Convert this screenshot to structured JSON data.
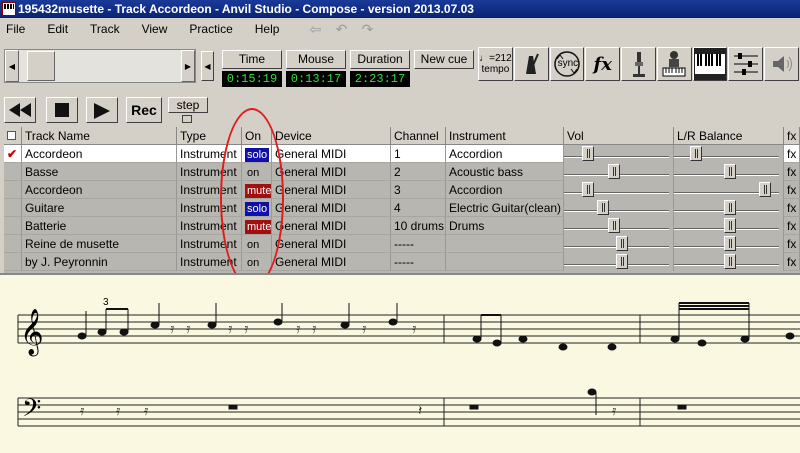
{
  "window": {
    "title": "195432musette - Track Accordeon - Anvil Studio - Compose - version 2013.07.03"
  },
  "menu": {
    "items": [
      "File",
      "Edit",
      "Track",
      "View",
      "Practice",
      "Help"
    ]
  },
  "toolbar": {
    "time_label": "Time",
    "time_value": "0:15:19",
    "mouse_label": "Mouse",
    "mouse_value": "0:13:17",
    "duration_label": "Duration",
    "duration_value": "2:23:17",
    "new_cue_label": "New cue",
    "tempo_value": "♩=212",
    "tempo_label": "tempo",
    "rec_label": "Rec",
    "step_label": "step",
    "sync_label": "sync",
    "fx_label": "fx",
    "icons": [
      "tempo-icon",
      "metronome-icon",
      "sync-icon",
      "fx-icon",
      "microphone-icon",
      "keyboard-player-icon",
      "piano-keyboard-icon",
      "mixer-icon",
      "speaker-icon"
    ]
  },
  "tracks": {
    "headers": {
      "track_name": "Track Name",
      "type": "Type",
      "on": "On",
      "device": "Device",
      "channel": "Channel",
      "instrument": "Instrument",
      "vol": "Vol",
      "balance": "L/R Balance",
      "fx": "fx"
    },
    "rows": [
      {
        "name": "Accordeon",
        "type": "Instrument",
        "on": "solo",
        "device": "General MIDI",
        "channel": "1",
        "instrument": "Accordion",
        "fx": "fx",
        "vol": 0.19,
        "balance": 0.17
      },
      {
        "name": "Basse",
        "type": "Instrument",
        "on": "on",
        "device": "General MIDI",
        "channel": "2",
        "instrument": "Acoustic bass",
        "fx": "fx",
        "vol": 0.47,
        "balance": 0.53
      },
      {
        "name": "Accordeon",
        "type": "Instrument",
        "on": "mute",
        "device": "General MIDI",
        "channel": "3",
        "instrument": "Accordion",
        "fx": "fx",
        "vol": 0.19,
        "balance": 0.9
      },
      {
        "name": "Guitare",
        "type": "Instrument",
        "on": "solo",
        "device": "General MIDI",
        "channel": "4",
        "instrument": "Electric Guitar(clean)",
        "fx": "fx",
        "vol": 0.35,
        "balance": 0.53
      },
      {
        "name": "Batterie",
        "type": "Instrument",
        "on": "mute",
        "device": "General MIDI",
        "channel": "10 drums",
        "instrument": "Drums",
        "fx": "fx",
        "vol": 0.47,
        "balance": 0.53
      },
      {
        "name": "Reine de musette",
        "type": "Instrument",
        "on": "on",
        "device": "General MIDI",
        "channel": "-----",
        "instrument": "",
        "fx": "fx",
        "vol": 0.55,
        "balance": 0.53
      },
      {
        "name": "by J. Peyronnin",
        "type": "Instrument",
        "on": "on",
        "device": "General MIDI",
        "channel": "-----",
        "instrument": "",
        "fx": "fx",
        "vol": 0.55,
        "balance": 0.53
      }
    ],
    "checkmark": "✔"
  },
  "score": {
    "tuplet": "3"
  },
  "colors": {
    "solo": "#1010a8",
    "mute": "#a01010",
    "annotation_circle": "#e21b1b",
    "score_background": "#fbf8e2",
    "lcd_text": "#30e030"
  }
}
